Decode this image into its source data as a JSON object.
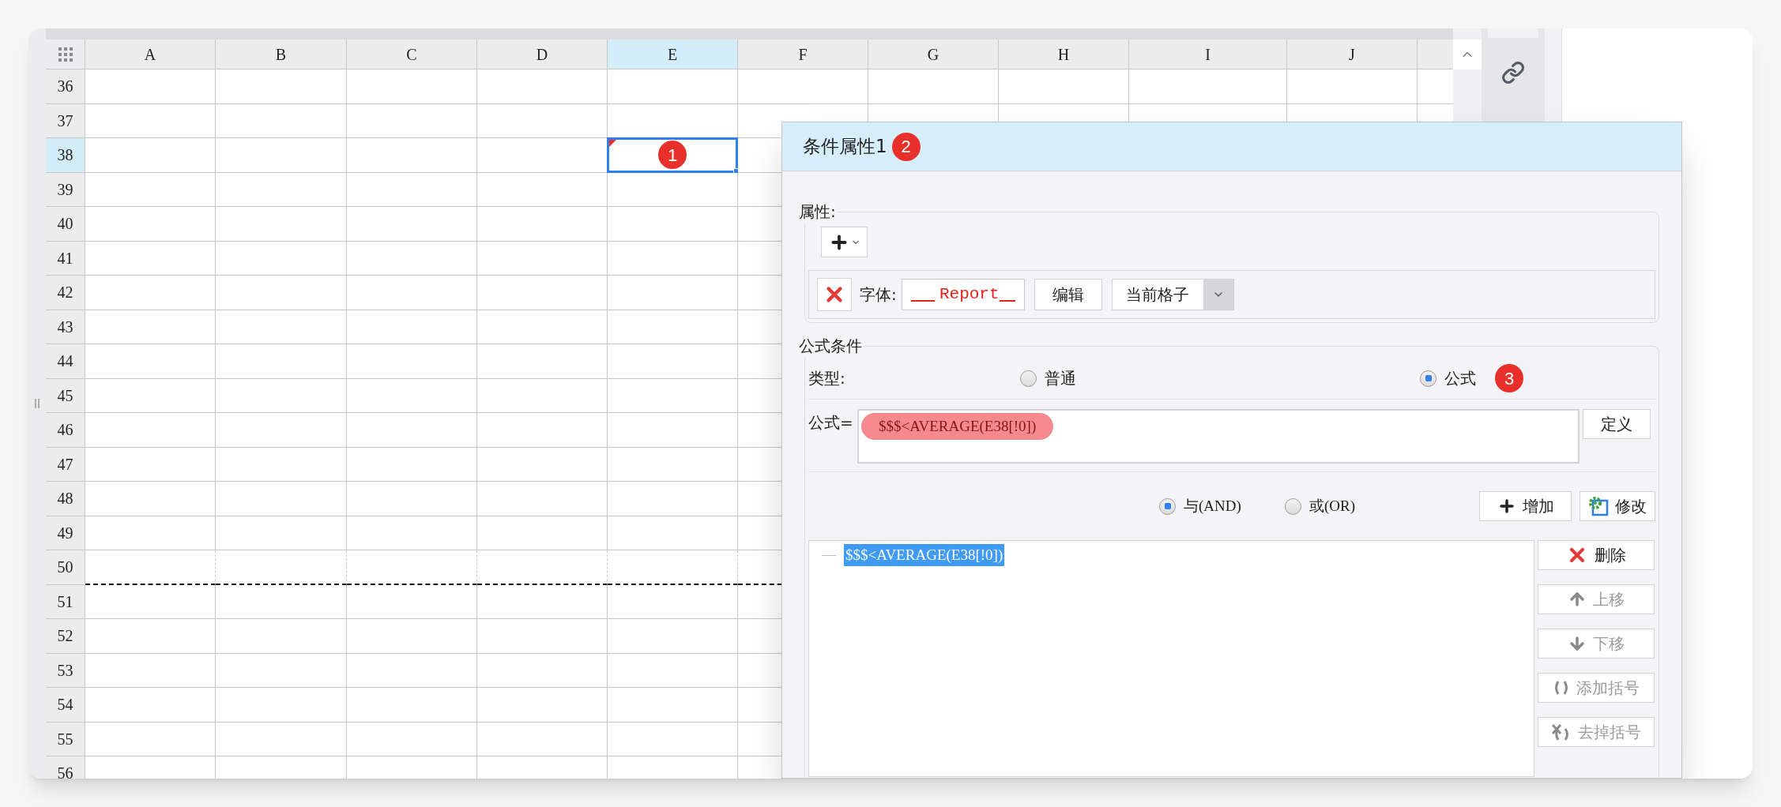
{
  "sheet": {
    "columns": [
      {
        "label": "A",
        "selected": false
      },
      {
        "label": "B",
        "selected": false
      },
      {
        "label": "C",
        "selected": false
      },
      {
        "label": "D",
        "selected": false
      },
      {
        "label": "E",
        "selected": true
      },
      {
        "label": "F",
        "selected": false
      },
      {
        "label": "G",
        "selected": false
      },
      {
        "label": "H",
        "selected": false
      },
      {
        "label": "I",
        "selected": false
      },
      {
        "label": "J",
        "selected": false
      }
    ],
    "rows": [
      {
        "label": "36",
        "selected": false,
        "page_break": false
      },
      {
        "label": "37",
        "selected": false,
        "page_break": false
      },
      {
        "label": "38",
        "selected": true,
        "page_break": false
      },
      {
        "label": "39",
        "selected": false,
        "page_break": false
      },
      {
        "label": "40",
        "selected": false,
        "page_break": false
      },
      {
        "label": "41",
        "selected": false,
        "page_break": false
      },
      {
        "label": "42",
        "selected": false,
        "page_break": false
      },
      {
        "label": "43",
        "selected": false,
        "page_break": false
      },
      {
        "label": "44",
        "selected": false,
        "page_break": false
      },
      {
        "label": "45",
        "selected": false,
        "page_break": false
      },
      {
        "label": "46",
        "selected": false,
        "page_break": false
      },
      {
        "label": "47",
        "selected": false,
        "page_break": false
      },
      {
        "label": "48",
        "selected": false,
        "page_break": false
      },
      {
        "label": "49",
        "selected": false,
        "page_break": false
      },
      {
        "label": "50",
        "selected": false,
        "page_break": true
      },
      {
        "label": "51",
        "selected": false,
        "page_break": false
      },
      {
        "label": "52",
        "selected": false,
        "page_break": false
      },
      {
        "label": "53",
        "selected": false,
        "page_break": false
      },
      {
        "label": "54",
        "selected": false,
        "page_break": false
      },
      {
        "label": "55",
        "selected": false,
        "page_break": false
      },
      {
        "label": "56",
        "selected": false,
        "page_break": false
      }
    ],
    "cell_badge": "1"
  },
  "dialog": {
    "title": "条件属性1",
    "title_badge": "2",
    "attributes": {
      "legend": "属性:",
      "font_label": "字体:",
      "font_preview": "Report",
      "edit_button": "编辑",
      "scope": "当前格子"
    },
    "formula_condition": {
      "legend": "公式条件",
      "type_label": "类型:",
      "types": [
        {
          "label": "普通",
          "selected": false
        },
        {
          "label": "公式",
          "selected": true,
          "badge": "3"
        }
      ],
      "formula_label": "公式=",
      "formula": "$$$<AVERAGE(E38[!0])",
      "define_button": "定义",
      "logic": [
        {
          "label": "与(AND)",
          "selected": true
        },
        {
          "label": "或(OR)",
          "selected": false
        }
      ],
      "add_button": "增加",
      "modify_button": "修改",
      "conditions": [
        {
          "text": "$$$<AVERAGE(E38[!0])",
          "selected": true
        }
      ],
      "side_buttons": [
        {
          "kind": "delete",
          "label": "删除",
          "disabled": false
        },
        {
          "kind": "up",
          "label": "上移",
          "disabled": true
        },
        {
          "kind": "down",
          "label": "下移",
          "disabled": true
        },
        {
          "kind": "add_brackets",
          "label": "添加括号",
          "disabled": true
        },
        {
          "kind": "remove_brackets",
          "label": "去掉括号",
          "disabled": true
        }
      ]
    }
  }
}
